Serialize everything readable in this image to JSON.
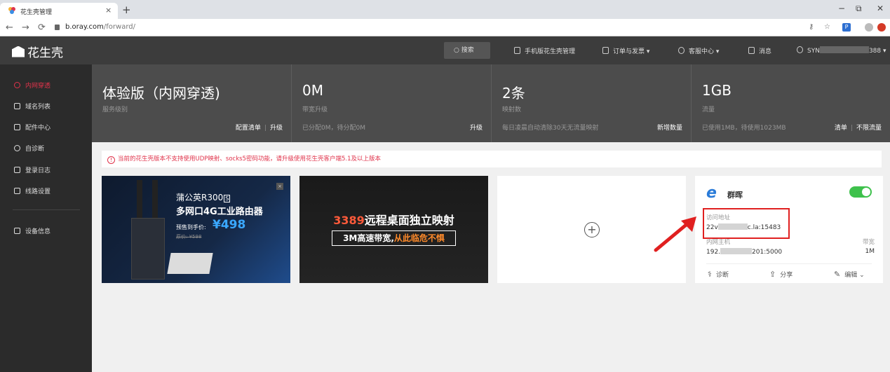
{
  "browser": {
    "tab_title": "花生壳管理",
    "tab_close": "×",
    "new_tab": "+",
    "url_domain": "b.oray.com",
    "url_path": "/forward/",
    "win_minimize": "−",
    "win_restore": "⧉",
    "win_close": "✕"
  },
  "header": {
    "logo_text": "花生壳",
    "search_label": "搜索",
    "mobile_label": "手机版花生壳管理",
    "orders_label": "订单与发票 ▾",
    "service_label": "客服中心 ▾",
    "messages_label": "消息",
    "user_prefix": "SYN",
    "user_suffix": "388 ▾"
  },
  "sidebar": {
    "items": [
      {
        "label": "内网穿透",
        "icon": "tunnel-icon",
        "active": true
      },
      {
        "label": "域名列表",
        "icon": "domain-list-icon"
      },
      {
        "label": "配件中心",
        "icon": "accessories-icon"
      },
      {
        "label": "自诊断",
        "icon": "diagnose-icon"
      },
      {
        "label": "登录日志",
        "icon": "log-icon"
      },
      {
        "label": "线路设置",
        "icon": "route-icon"
      },
      {
        "label": "设备信息",
        "icon": "device-icon"
      }
    ]
  },
  "stats": [
    {
      "value": "体验版（内网穿透)",
      "label": "服务级别",
      "foot": "",
      "actions": [
        "配置清单",
        "升级"
      ]
    },
    {
      "value": "0M",
      "label": "带宽升级",
      "foot": "已分配0M，待分配0M",
      "actions": [
        "升级"
      ]
    },
    {
      "value": "2条",
      "label": "映射数",
      "foot": "每日凌晨自动清除30天无流量映射",
      "actions": [
        "新增数量"
      ]
    },
    {
      "value": "1GB",
      "label": "流量",
      "foot": "已使用1MB，待使用1023MB",
      "actions": [
        "清单",
        "不限流量"
      ]
    }
  ],
  "notice": {
    "icon": "!",
    "text": "当前的花生壳版本不支持使用UDP映射、socks5密码功能，请升级使用花生壳客户端5.1及以上版本"
  },
  "ad1": {
    "title1": "蒲公英R300",
    "badge": "S",
    "title2": "多网口4G工业路由器",
    "pre_label": "预售到手价:",
    "price": "¥498",
    "orig": "原价: ¥598",
    "close": "×"
  },
  "ad2": {
    "title_num": "3389",
    "title_rest": "远程桌面独立映射",
    "sub_a": "3M高速带宽,",
    "sub_b": "从此临危不惧"
  },
  "add_card": {
    "plus": "+"
  },
  "device": {
    "name": "群晖",
    "enabled": true,
    "access_label": "访问地址",
    "access_prefix": "22v",
    "access_suffix": "c.la:15483",
    "host_label": "内网主机",
    "host_prefix": "192.",
    "host_suffix": "201:5000",
    "bandwidth_label": "带宽",
    "bandwidth_value": "1M",
    "diagnose": "诊断",
    "share": "分享",
    "edit": "编辑 ⌄"
  },
  "colors": {
    "accent_red": "#e0334b",
    "toggle_green": "#3ec14c",
    "highlight": "#e02020"
  }
}
